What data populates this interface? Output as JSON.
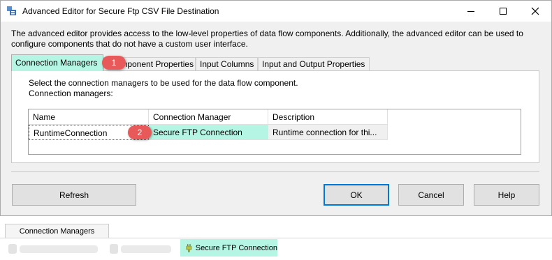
{
  "window": {
    "title": "Advanced Editor for Secure Ftp CSV File Destination"
  },
  "description": {
    "line1": "The advanced editor provides access to the low-level properties of data flow components. Additionally, the advanced editor can be used to",
    "line2": "configure components that do not have a custom user interface."
  },
  "tabs": [
    {
      "label": "Connection Managers",
      "active": true
    },
    {
      "label": "Component Properties",
      "active": false
    },
    {
      "label": "Input Columns",
      "active": false
    },
    {
      "label": "Input and Output Properties",
      "active": false
    }
  ],
  "panel": {
    "instruction": "Select the connection managers to be used for the data flow component.",
    "grid_label": "Connection managers:"
  },
  "grid": {
    "columns": [
      "Name",
      "Connection Manager",
      "Description"
    ],
    "rows": [
      {
        "name": "RuntimeConnection",
        "connection_manager": "Secure FTP Connection",
        "description": "Runtime connection for thi..."
      }
    ]
  },
  "callouts": [
    "1",
    "2"
  ],
  "buttons": {
    "refresh": "Refresh",
    "ok": "OK",
    "cancel": "Cancel",
    "help": "Help"
  },
  "connection_tray": {
    "tab_label": "Connection Managers",
    "item_label": "Secure FTP Connection",
    "item_icon": "plug-icon"
  },
  "colors": {
    "highlight": "#b5f5e3",
    "callout": "#e85a5a"
  }
}
